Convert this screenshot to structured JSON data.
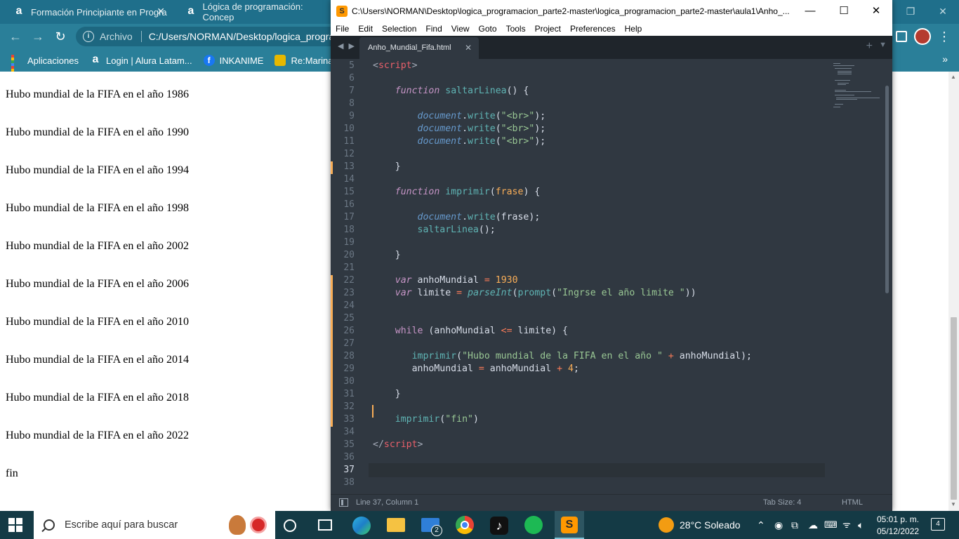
{
  "chrome": {
    "tabs": [
      {
        "title": "Formación Principiante en Progra"
      },
      {
        "title": "Lógica de programación: Concep"
      }
    ],
    "address": {
      "security_label": "Archivo",
      "url": "C:/Users/NORMAN/Desktop/logica_progra"
    },
    "bookmarks": [
      {
        "label": "Aplicaciones"
      },
      {
        "label": "Login | Alura Latam..."
      },
      {
        "label": "INKANIME"
      },
      {
        "label": "Re:Marina Capi"
      }
    ],
    "page_lines": [
      "Hubo mundial de la FIFA en el año 1986",
      "Hubo mundial de la FIFA en el año 1990",
      "Hubo mundial de la FIFA en el año 1994",
      "Hubo mundial de la FIFA en el año 1998",
      "Hubo mundial de la FIFA en el año 2002",
      "Hubo mundial de la FIFA en el año 2006",
      "Hubo mundial de la FIFA en el año 2010",
      "Hubo mundial de la FIFA en el año 2014",
      "Hubo mundial de la FIFA en el año 2018",
      "Hubo mundial de la FIFA en el año 2022",
      "fin"
    ]
  },
  "sublime": {
    "window_title": "C:\\Users\\NORMAN\\Desktop\\logica_programacion_parte2-master\\logica_programacion_parte2-master\\aula1\\Anho_...",
    "menu": [
      "File",
      "Edit",
      "Selection",
      "Find",
      "View",
      "Goto",
      "Tools",
      "Project",
      "Preferences",
      "Help"
    ],
    "tab_name": "Anho_Mundial_Fifa.html",
    "line_numbers": [
      "5",
      "6",
      "7",
      "8",
      "9",
      "10",
      "11",
      "12",
      "13",
      "14",
      "15",
      "16",
      "17",
      "18",
      "19",
      "20",
      "21",
      "22",
      "23",
      "24",
      "25",
      "26",
      "27",
      "28",
      "29",
      "30",
      "31",
      "32",
      "33",
      "34",
      "35",
      "36",
      "37",
      "38"
    ],
    "active_line": "37",
    "status": {
      "position": "Line 37, Column 1",
      "tab_size": "Tab Size: 4",
      "syntax": "HTML"
    }
  },
  "code": {
    "script_open": "script",
    "script_close": "script",
    "kw_function": "function",
    "fn_saltar": "saltarLinea",
    "fn_imprimir": "imprimir",
    "param_frase": "frase",
    "obj_document": "document",
    "m_write": "write",
    "str_br": "\"<br>\"",
    "kw_var": "var",
    "v_anho": "anhoMundial",
    "v_limite": "limite",
    "n_1930": "1930",
    "n_4": "4",
    "fn_parseInt": "parseInt",
    "fn_prompt": "prompt",
    "str_prompt": "\"Ingrse el año limite \"",
    "kw_while": "while",
    "str_hubo": "\"Hubo mundial de la FIFA en el año \"",
    "str_fin": "\"fin\""
  },
  "taskbar": {
    "search_placeholder": "Escribe aquí para buscar",
    "weather": "28°C  Soleado",
    "time": "05:01 p. m.",
    "date": "05/12/2022",
    "notifications": "4"
  },
  "colors": {
    "chrome_frame": "#1f6f8b",
    "sublime_bg": "#303841",
    "taskbar": "#143a45",
    "caret": "#f9ae58"
  }
}
